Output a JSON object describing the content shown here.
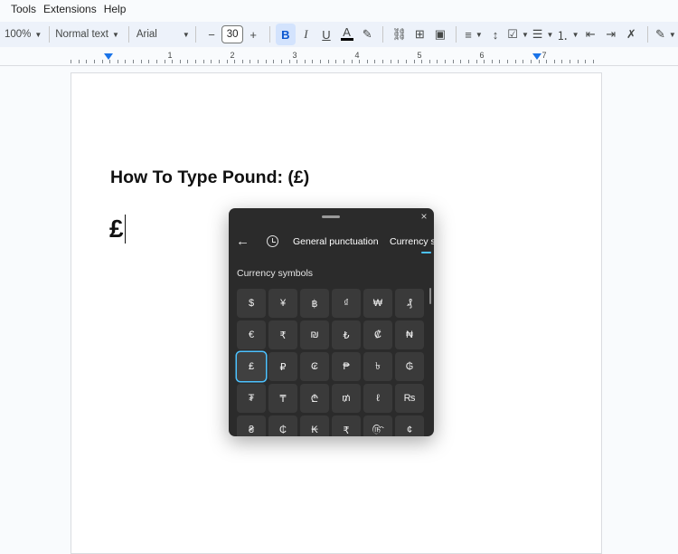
{
  "menu": [
    "Tools",
    "Extensions",
    "Help"
  ],
  "toolbar": {
    "zoom": "100%",
    "style": "Normal text",
    "font": "Arial",
    "minus": "−",
    "font_size": "30",
    "plus": "+",
    "bold": "B",
    "italic": "I",
    "underline": "U",
    "text_color": "A"
  },
  "ruler": {
    "numbers": [
      "1",
      "2",
      "3",
      "4",
      "5",
      "6",
      "7"
    ]
  },
  "document": {
    "title": "How To Type Pound: (£)",
    "typed_symbol": "£"
  },
  "emoji_panel": {
    "close": "×",
    "back": "←",
    "tabs": [
      "General punctuation",
      "Currency s"
    ],
    "section_title": "Currency symbols",
    "symbols": [
      [
        "$",
        "¥",
        "฿",
        "₫",
        "₩",
        "₰"
      ],
      [
        "€",
        "₹",
        "₪",
        "₺",
        "₡",
        "₦"
      ],
      [
        "₤",
        "₽",
        "₢",
        "₱",
        "৳",
        "₲"
      ],
      [
        "₮",
        "₸",
        "₾",
        "₥",
        "ℓ",
        "₨"
      ],
      [
        "₴",
        "₵",
        "₭",
        "₹",
        "௹",
        "¢"
      ]
    ],
    "selected": "₤"
  }
}
